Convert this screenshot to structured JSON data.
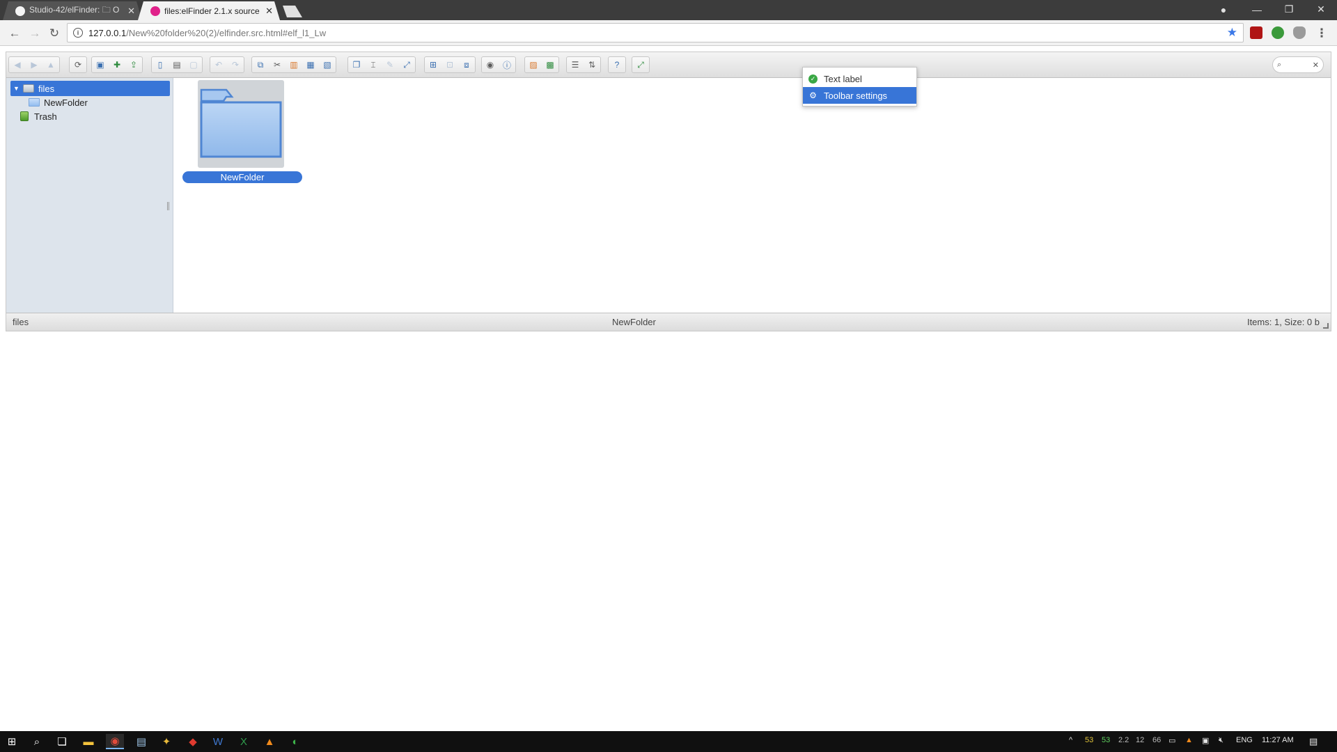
{
  "browser": {
    "tabs": [
      {
        "title": "Studio-42/elFinder: 🗀 O",
        "active": false
      },
      {
        "title": "files:elFinder 2.1.x source",
        "active": true
      }
    ],
    "url_host": "127.0.0.1",
    "url_path": "/New%20folder%20(2)/elfinder.src.html#elf_l1_Lw",
    "window_controls": {
      "minimize": "—",
      "restore": "❐",
      "close": "✕"
    }
  },
  "elfinder": {
    "search": {
      "placeholder": "",
      "value": ""
    },
    "tree": [
      {
        "label": "files",
        "selected": true
      },
      {
        "label": "NewFolder",
        "selected": false
      },
      {
        "label": "Trash",
        "selected": false
      }
    ],
    "files": [
      {
        "name": "NewFolder",
        "selected": true
      }
    ],
    "context_menu": [
      {
        "label": "Text label",
        "checked": true
      },
      {
        "label": "Toolbar settings",
        "highlighted": true
      }
    ],
    "statusbar": {
      "path": "files",
      "selected": "NewFolder",
      "summary": "Items: 1, Size: 0 b"
    },
    "colors": {
      "selection": "#3875d7",
      "navbar": "#dde4ec"
    }
  },
  "taskbar": {
    "tray_values": [
      "53",
      "53",
      "2.2",
      "12",
      "66"
    ],
    "language": "ENG",
    "time": "11:27 AM"
  }
}
